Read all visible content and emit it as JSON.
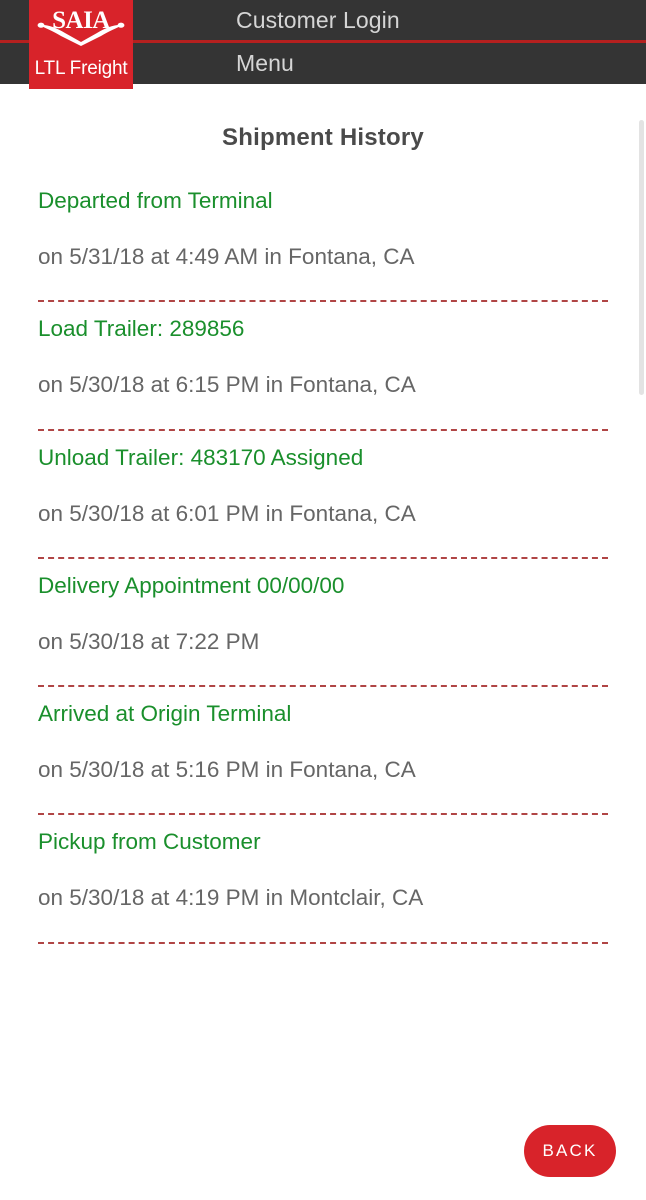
{
  "header": {
    "nav": [
      {
        "label": "Customer Login",
        "name": "customer-login"
      },
      {
        "label": "Menu",
        "name": "menu"
      }
    ],
    "background_color": "#343434",
    "divider_color": "#b5201f"
  },
  "logo": {
    "wordmark": "SAIA",
    "tagline": "LTL Freight",
    "color": "#d8232a"
  },
  "page": {
    "title": "Shipment History",
    "title_color": "#4a4a4a",
    "status_color": "#1a8f2c",
    "detail_color": "#666666",
    "separator_color": "#b04545"
  },
  "history": [
    {
      "status": "Departed from Terminal",
      "detail": "on 5/31/18 at 4:49 AM in Fontana, CA"
    },
    {
      "status": "Load Trailer: 289856",
      "detail": "on 5/30/18 at 6:15 PM in Fontana, CA"
    },
    {
      "status": "Unload Trailer: 483170 Assigned",
      "detail": "on 5/30/18 at 6:01 PM in Fontana, CA"
    },
    {
      "status": "Delivery Appointment 00/00/00",
      "detail": "on 5/30/18 at 7:22 PM"
    },
    {
      "status": "Arrived at Origin Terminal",
      "detail": "on 5/30/18 at 5:16 PM in Fontana, CA"
    },
    {
      "status": "Pickup from Customer",
      "detail": "on 5/30/18 at 4:19 PM in Montclair, CA"
    }
  ],
  "footer": {
    "back_label": "BACK",
    "back_color": "#d8232a"
  }
}
